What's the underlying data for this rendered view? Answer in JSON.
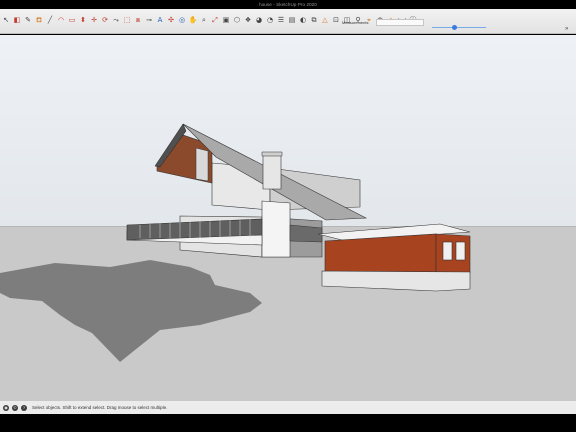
{
  "window": {
    "title": "house - SketchUp Pro 2020"
  },
  "toolbar": {
    "measurements_label": "Measurements",
    "measurements_value": "",
    "tools": [
      {
        "name": "select-tool-icon",
        "glyph": "↖",
        "color": ""
      },
      {
        "name": "eraser-tool-icon",
        "glyph": "◧",
        "color": "red"
      },
      {
        "name": "pencil-tool-icon",
        "glyph": "✎",
        "color": ""
      },
      {
        "name": "paint-bucket-icon",
        "glyph": "⛾",
        "color": "orange"
      },
      {
        "name": "line-tool-icon",
        "glyph": "╱",
        "color": ""
      },
      {
        "name": "arc-tool-icon",
        "glyph": "◠",
        "color": "red"
      },
      {
        "name": "rectangle-tool-icon",
        "glyph": "▭",
        "color": "red"
      },
      {
        "name": "push-pull-icon",
        "glyph": "⬍",
        "color": "red"
      },
      {
        "name": "move-tool-icon",
        "glyph": "✛",
        "color": "red"
      },
      {
        "name": "rotate-tool-icon",
        "glyph": "⟳",
        "color": "red"
      },
      {
        "name": "follow-me-icon",
        "glyph": "⤳",
        "color": ""
      },
      {
        "name": "scale-tool-icon",
        "glyph": "⬚",
        "color": "red"
      },
      {
        "name": "offset-tool-icon",
        "glyph": "⧈",
        "color": "red"
      },
      {
        "name": "tape-measure-icon",
        "glyph": "⊸",
        "color": ""
      },
      {
        "name": "text-tool-icon",
        "glyph": "A",
        "color": "blue"
      },
      {
        "name": "axes-tool-icon",
        "glyph": "✣",
        "color": "red"
      },
      {
        "name": "orbit-tool-icon",
        "glyph": "◎",
        "color": "blue"
      },
      {
        "name": "pan-tool-icon",
        "glyph": "✋",
        "color": "orange"
      },
      {
        "name": "zoom-tool-icon",
        "glyph": "⌕",
        "color": ""
      },
      {
        "name": "zoom-extents-icon",
        "glyph": "⤢",
        "color": "red"
      },
      {
        "name": "warehouse-icon",
        "glyph": "▣",
        "color": ""
      },
      {
        "name": "extension-icon",
        "glyph": "⬡",
        "color": ""
      },
      {
        "name": "components-icon",
        "glyph": "❖",
        "color": ""
      },
      {
        "name": "materials-icon",
        "glyph": "◕",
        "color": ""
      },
      {
        "name": "styles-icon",
        "glyph": "◔",
        "color": ""
      },
      {
        "name": "layers-icon",
        "glyph": "☰",
        "color": ""
      },
      {
        "name": "scenes-icon",
        "glyph": "▤",
        "color": ""
      },
      {
        "name": "shadows-icon",
        "glyph": "◐",
        "color": ""
      },
      {
        "name": "outliner-icon",
        "glyph": "⧉",
        "color": ""
      },
      {
        "name": "sandbox-icon",
        "glyph": "△",
        "color": "orange"
      },
      {
        "name": "section-plane-icon",
        "glyph": "⊡",
        "color": ""
      },
      {
        "name": "camera-icon",
        "glyph": "◫",
        "color": ""
      },
      {
        "name": "walk-icon",
        "glyph": "⚲",
        "color": ""
      },
      {
        "name": "position-camera-icon",
        "glyph": "⌖",
        "color": "orange"
      },
      {
        "name": "look-around-icon",
        "glyph": "◉",
        "color": ""
      },
      {
        "name": "protractor-icon",
        "glyph": "◭",
        "color": "orange"
      },
      {
        "name": "dimension-icon",
        "glyph": "⟷",
        "color": ""
      },
      {
        "name": "info-icon",
        "glyph": "ⓘ",
        "color": ""
      }
    ]
  },
  "slider": {
    "value_label": ""
  },
  "status": {
    "text": "Select objects. Shift to extend select. Drag mouse to select multiple."
  },
  "colors": {
    "sky_top": "#eef2f6",
    "ground": "#c9c9c9",
    "shadow": "#7d7d7d",
    "wall": "#e6e6e6",
    "wood": "#8b4a2b",
    "brick": "#a8431f"
  }
}
